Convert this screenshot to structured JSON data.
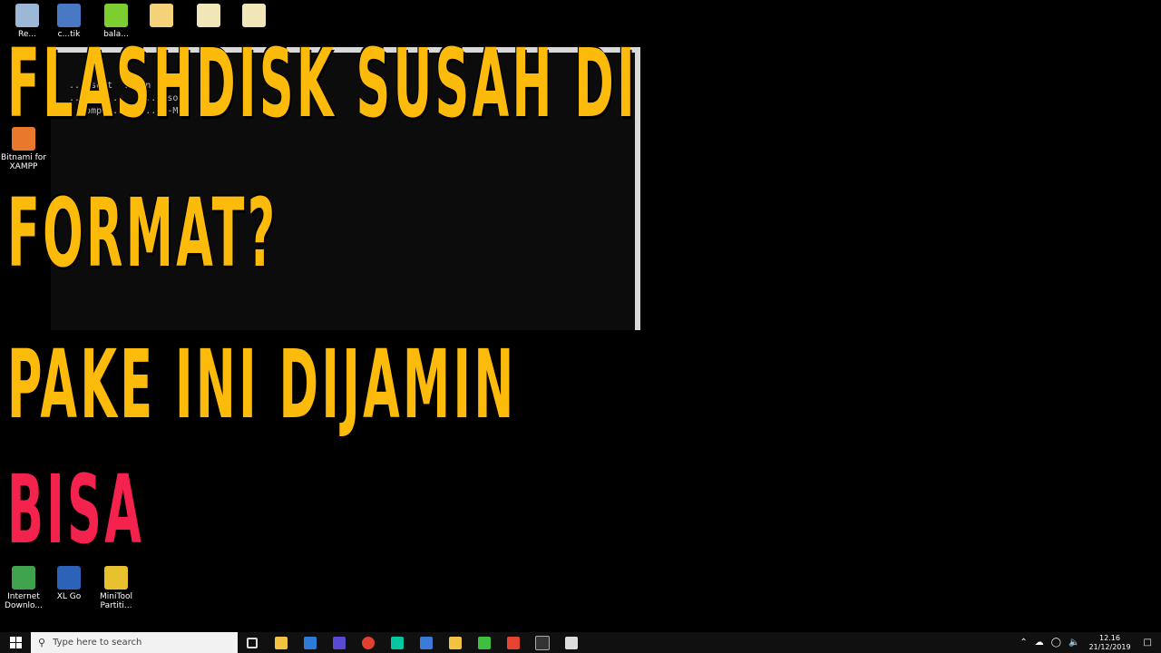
{
  "desktop": {
    "icons": [
      {
        "label": "Re...",
        "icon": "recycle-bin-icon",
        "color": "#9db8d6"
      },
      {
        "label": "c...tik",
        "icon": "network-tool-icon",
        "color": "#4a79c4"
      },
      {
        "label": "bala...",
        "icon": "cube-icon",
        "color": "#7ccf2f"
      },
      {
        "label": "",
        "icon": "folder-icon",
        "color": "#f3d27a"
      },
      {
        "label": "",
        "icon": "file-icon",
        "color": "#f0e6b8"
      },
      {
        "label": "",
        "icon": "file-icon",
        "color": "#f0e6b8"
      },
      {
        "label": "Bitnami for XAMPP",
        "icon": "bitnami-icon",
        "color": "#e8782c"
      },
      {
        "label": "Internet Downlo...",
        "icon": "internet-download-icon",
        "color": "#3fa34d"
      },
      {
        "label": "XL Go",
        "icon": "xl-go-icon",
        "color": "#2c63b8"
      },
      {
        "label": "MiniTool Partiti...",
        "icon": "minitool-icon",
        "color": "#e7c12e"
      }
    ]
  },
  "console": {
    "lines": [
      "...osoft  ...on 10.",
      "...righ...    ...osof",
      "...ompu...   ...OP-MLM"
    ]
  },
  "headline": {
    "line1": "FLASHDISK SUSAH DI",
    "line2": "FORMAT?",
    "line3": "PAKE INI DIJAMIN",
    "line4": "BISA"
  },
  "taskbar": {
    "search_placeholder": "Type here to search",
    "time": "12.16",
    "date": "21/12/2019",
    "apps": [
      {
        "icon": "task-view-icon",
        "color": "#dddddd"
      },
      {
        "icon": "file-explorer-icon",
        "color": "#f3c242"
      },
      {
        "icon": "app-icon",
        "color": "#2d7bd6"
      },
      {
        "icon": "app-icon",
        "color": "#5a4ad1"
      },
      {
        "icon": "chrome-icon",
        "color": "#e0402f"
      },
      {
        "icon": "audition-icon",
        "color": "#00c8a0"
      },
      {
        "icon": "network-icon",
        "color": "#3a7bd5"
      },
      {
        "icon": "folder-icon",
        "color": "#f3c242"
      },
      {
        "icon": "camtasia-icon",
        "color": "#3fbf3f"
      },
      {
        "icon": "app-icon",
        "color": "#e7442f"
      },
      {
        "icon": "terminal-icon",
        "color": "#333333"
      },
      {
        "icon": "app-icon",
        "color": "#dddddd"
      }
    ]
  }
}
